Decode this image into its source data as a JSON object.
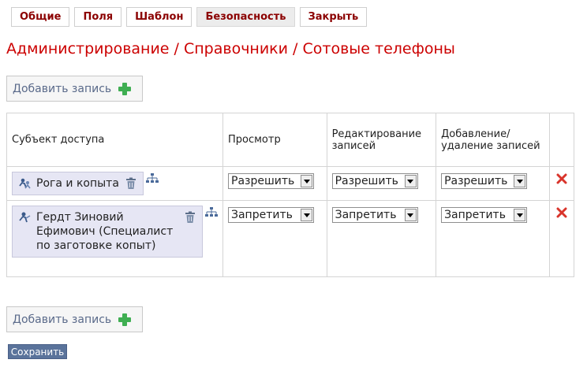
{
  "tabs": [
    {
      "label": "Общие"
    },
    {
      "label": "Поля"
    },
    {
      "label": "Шаблон"
    },
    {
      "label": "Безопасность",
      "active": true
    },
    {
      "label": "Закрыть"
    }
  ],
  "page_title": "Администрирование / Справочники / Сотовые телефоны",
  "add_record_label": "Добавить запись",
  "table": {
    "headers": {
      "subject": "Субъект доступа",
      "view": "Просмотр",
      "edit": "Редактирование записей",
      "add_delete": "Добавление/ удаление записей"
    },
    "rows": [
      {
        "subject": "Рога и копыта",
        "view": "Разрешить",
        "edit": "Разрешить",
        "add_delete": "Разрешить"
      },
      {
        "subject": "Гердт Зиновий Ефимович (Специалист по заготовке копыт)",
        "view": "Запретить",
        "edit": "Запретить",
        "add_delete": "Запретить"
      }
    ]
  },
  "save_label": "Сохранить",
  "colors": {
    "tab_text": "#8b0000",
    "title": "#cc0000",
    "plus": "#3fae52",
    "delete": "#d9342b",
    "subject_bg": "#e6e6f4",
    "save_bg": "#5a739b"
  },
  "icons": {
    "subject": "user-group-icon",
    "trash": "trash-icon",
    "hierarchy": "hierarchy-icon",
    "delete": "delete-x-icon",
    "add": "plus-icon"
  }
}
